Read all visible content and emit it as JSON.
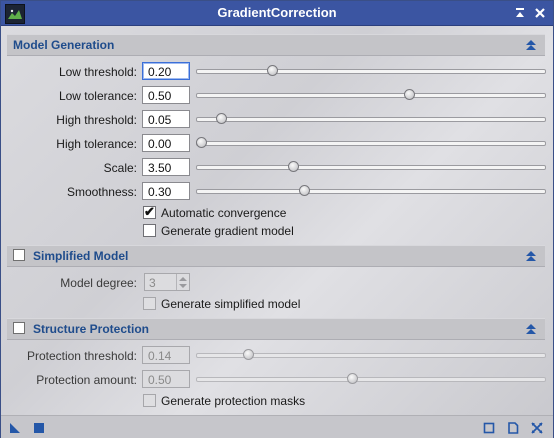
{
  "window": {
    "title": "GradientCorrection"
  },
  "model_generation": {
    "title": "Model Generation",
    "rows": [
      {
        "label": "Low threshold:",
        "value": "0.20",
        "fraction": 0.21
      },
      {
        "label": "Low tolerance:",
        "value": "0.50",
        "fraction": 0.615
      },
      {
        "label": "High threshold:",
        "value": "0.05",
        "fraction": 0.06
      },
      {
        "label": "High tolerance:",
        "value": "0.00",
        "fraction": 0.0
      },
      {
        "label": "Scale:",
        "value": "3.50",
        "fraction": 0.27
      },
      {
        "label": "Smoothness:",
        "value": "0.30",
        "fraction": 0.305
      }
    ],
    "auto_convergence_label": "Automatic convergence",
    "auto_convergence_checked": true,
    "generate_gradient_label": "Generate gradient model",
    "generate_gradient_checked": false
  },
  "simplified_model": {
    "title": "Simplified Model",
    "degree_label": "Model degree:",
    "degree_value": "3",
    "generate_label": "Generate simplified model"
  },
  "structure_protection": {
    "title": "Structure Protection",
    "rows": [
      {
        "label": "Protection threshold:",
        "value": "0.14",
        "fraction": 0.14
      },
      {
        "label": "Protection amount:",
        "value": "0.50",
        "fraction": 0.445
      }
    ],
    "masks_label": "Generate protection masks"
  },
  "colors": {
    "title_bar": "#3b55a2",
    "section_text": "#1f4c8c",
    "footer_icon": "#2457a8"
  }
}
